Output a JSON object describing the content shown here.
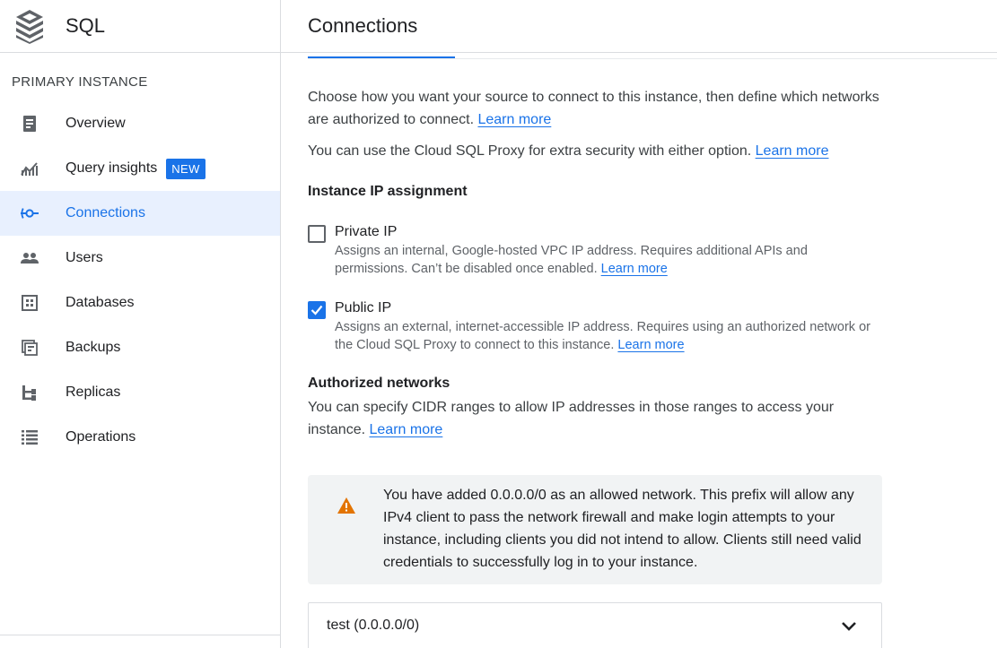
{
  "sidebar": {
    "app_name": "SQL",
    "section_label": "PRIMARY INSTANCE",
    "items": [
      {
        "label": "Overview",
        "icon": "overview-icon"
      },
      {
        "label": "Query insights",
        "icon": "query-insights-icon",
        "badge": "NEW"
      },
      {
        "label": "Connections",
        "icon": "connections-icon",
        "active": true
      },
      {
        "label": "Users",
        "icon": "users-icon"
      },
      {
        "label": "Databases",
        "icon": "databases-icon"
      },
      {
        "label": "Backups",
        "icon": "backups-icon"
      },
      {
        "label": "Replicas",
        "icon": "replicas-icon"
      },
      {
        "label": "Operations",
        "icon": "operations-icon"
      }
    ]
  },
  "main": {
    "title": "Connections",
    "intro": {
      "text": "Choose how you want your source to connect to this instance, then define which networks are authorized to connect.",
      "link": "Learn more"
    },
    "proxy": {
      "text": "You can use the Cloud SQL Proxy for extra security with either option.",
      "link": "Learn more"
    },
    "ip_assignment": {
      "heading": "Instance IP assignment",
      "private": {
        "label": "Private IP",
        "checked": false,
        "desc": "Assigns an internal, Google-hosted VPC IP address. Requires additional APIs and permissions. Can’t be disabled once enabled.",
        "link": "Learn more"
      },
      "public": {
        "label": "Public IP",
        "checked": true,
        "desc": "Assigns an external, internet-accessible IP address. Requires using an authorized network or the Cloud SQL Proxy to connect to this instance.",
        "link": "Learn more"
      }
    },
    "authorized": {
      "heading": "Authorized networks",
      "text": "You can specify CIDR ranges to allow IP addresses in those ranges to access your instance.",
      "link": "Learn more"
    },
    "warning": {
      "icon": "warning-icon",
      "text": "You have added 0.0.0.0/0 as an allowed network. This prefix will allow any IPv4 client to pass the network firewall and make login attempts to your instance, including clients you did not intend to allow. Clients still need valid credentials to successfully log in to your instance."
    },
    "network": {
      "label": "test (0.0.0.0/0)"
    }
  },
  "colors": {
    "accent": "#1a73e8",
    "warning": "#e37400",
    "active_bg": "#e8f0fe"
  }
}
